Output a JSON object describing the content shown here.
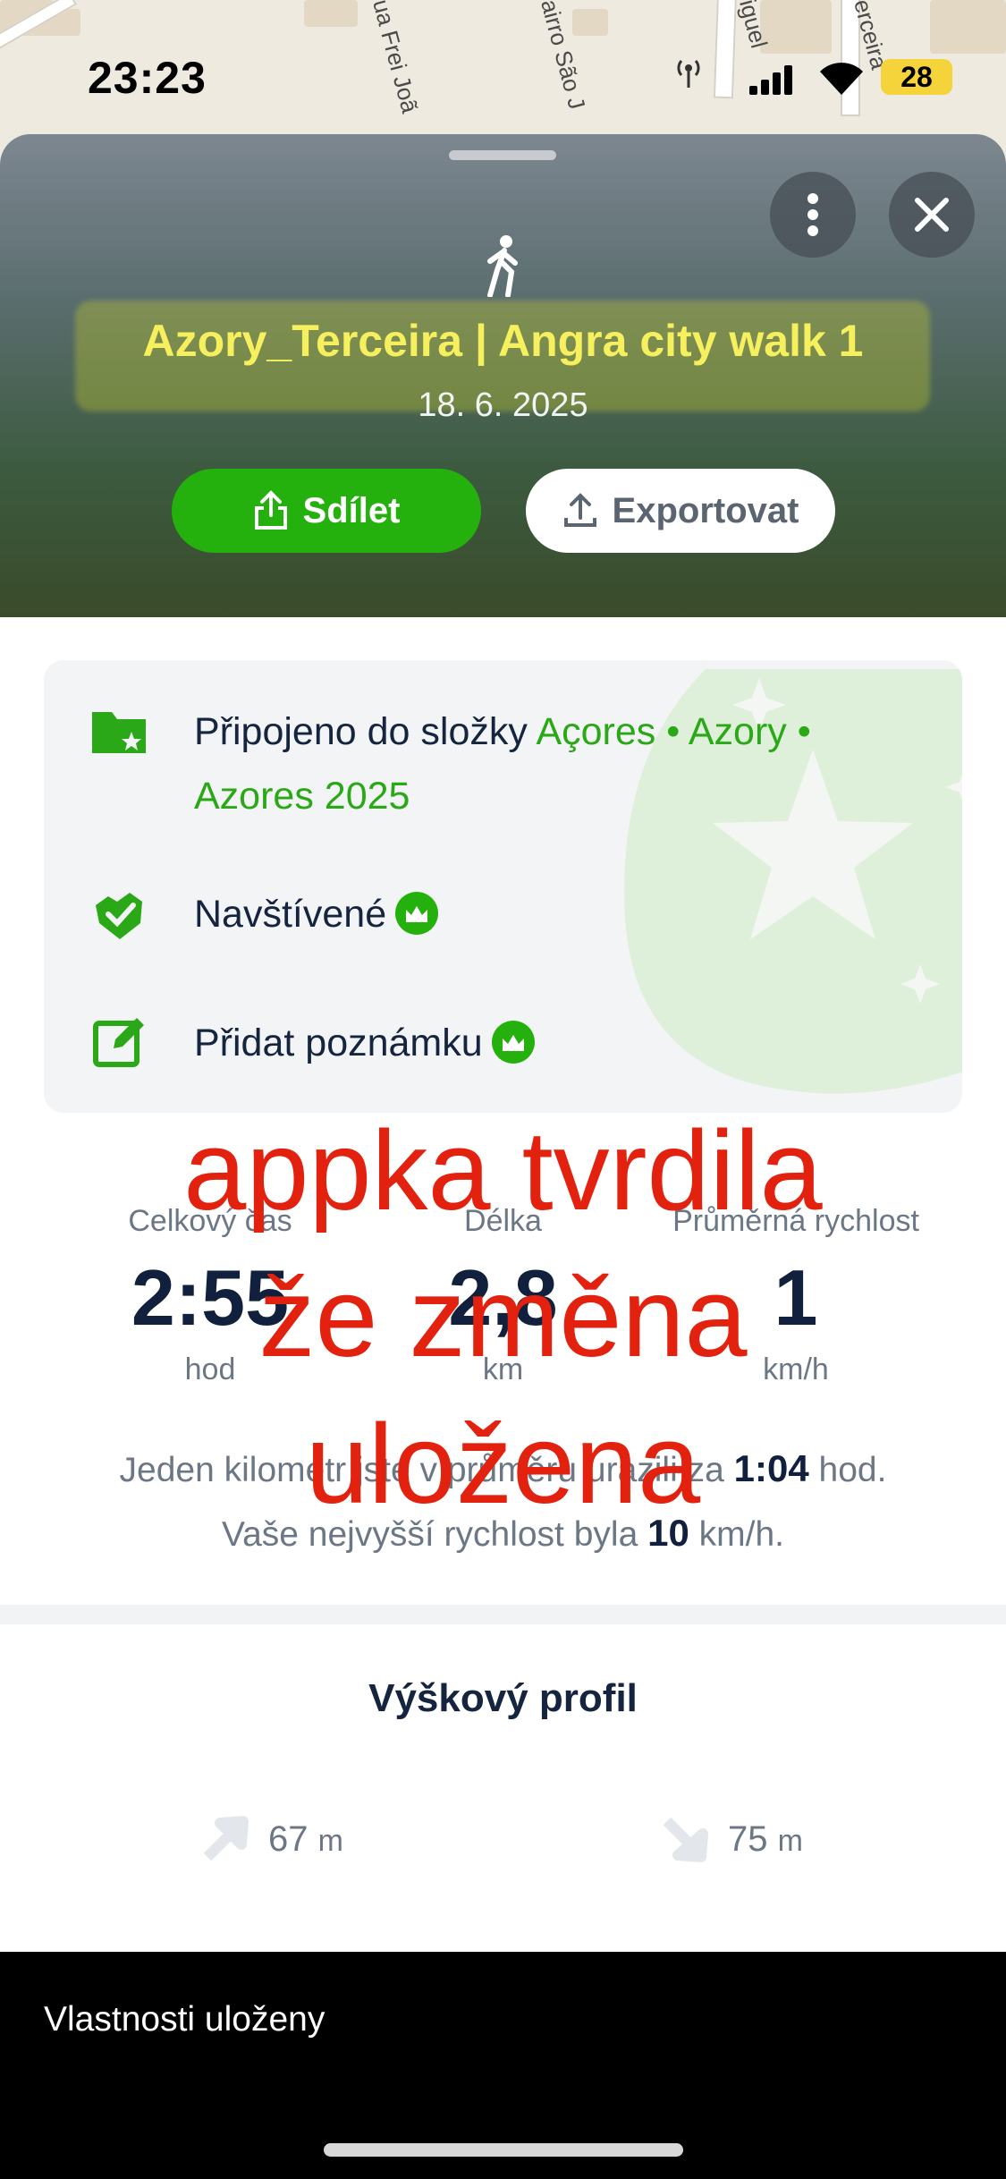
{
  "status_bar": {
    "time": "23:23",
    "battery": "28"
  },
  "map": {
    "streets": [
      "ua Frei Joã",
      "airro São J",
      "iguel",
      "erceira"
    ]
  },
  "header": {
    "title": "Azory_Terceira | Angra city walk 1",
    "date": "18. 6. 2025",
    "share_label": "Sdílet",
    "export_label": "Exportovat"
  },
  "info": {
    "folder_prefix": "Připojeno do složky",
    "folder_path_line1": "Açores • Azory •",
    "folder_path_line2": "Azores 2025",
    "visited_label": "Navštívené",
    "note_label": "Přidat poznámku"
  },
  "stats": {
    "total_time": {
      "label": "Celkový čas",
      "value": "2:55",
      "unit": "hod"
    },
    "distance": {
      "label": "Délka",
      "value": "2,8",
      "unit": "km"
    },
    "avg_speed": {
      "label": "Průměrná rychlost",
      "value": "1",
      "unit": "km/h"
    }
  },
  "summary": {
    "pace_prefix": "Jeden kilometr jste v průměru urazili za",
    "pace_value": "1:04",
    "pace_suffix": "hod.",
    "max_prefix": "Vaše nejvyšší rychlost byla",
    "max_value": "10",
    "max_suffix": "km/h."
  },
  "annotation": {
    "line1": "appka tvrdila",
    "line2": "že změna",
    "line3": "uložena"
  },
  "elevation": {
    "title": "Výškový profil",
    "ascent": "67",
    "descent": "75",
    "unit": "m"
  },
  "toast": {
    "text": "Vlastnosti uloženy"
  },
  "colors": {
    "accent": "#25b10d",
    "title_yellow": "#f6ef5e",
    "annotation_red": "#e3210f"
  }
}
